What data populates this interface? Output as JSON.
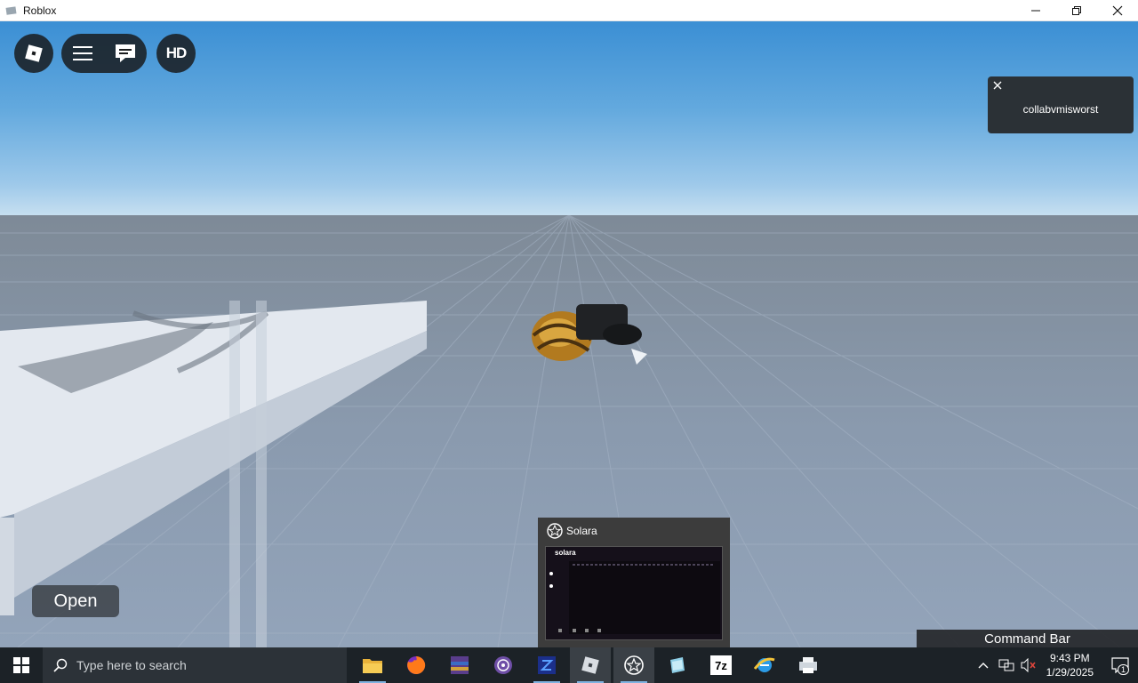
{
  "window": {
    "title": "Roblox"
  },
  "hud": {
    "hd_label": "HD"
  },
  "notification": {
    "text": "collabvmisworst"
  },
  "open_button": {
    "label": "Open"
  },
  "command_bar": {
    "label": "Command Bar"
  },
  "thumbnail": {
    "title": "Solara",
    "preview_name": "solara"
  },
  "taskbar": {
    "search_placeholder": "Type here to search",
    "apps": [
      {
        "name": "file-explorer-icon"
      },
      {
        "name": "firefox-icon"
      },
      {
        "name": "winrar-icon"
      },
      {
        "name": "tor-browser-icon"
      },
      {
        "name": "solara-blue-icon"
      },
      {
        "name": "roblox-icon"
      },
      {
        "name": "solara-icon"
      },
      {
        "name": "app-icon"
      },
      {
        "name": "7zip-icon"
      },
      {
        "name": "internet-explorer-icon"
      },
      {
        "name": "printer-icon"
      }
    ],
    "sevenzip_label": "7z",
    "time": "9:43 PM",
    "date": "1/29/2025",
    "notification_count": "1"
  },
  "colors": {
    "sky_top": "#3b8fd4",
    "floor": "#8c9db1",
    "taskbar": "#1c2227",
    "hud": "#191b1d"
  }
}
